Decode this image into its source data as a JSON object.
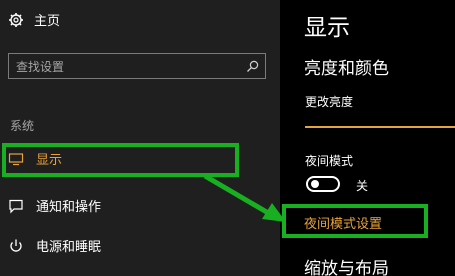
{
  "sidebar": {
    "home_label": "主页",
    "search_placeholder": "查找设置",
    "section_label": "系统",
    "items": [
      {
        "label": "显示",
        "icon": "monitor-icon",
        "active": true
      },
      {
        "label": "通知和操作",
        "icon": "message-icon",
        "active": false
      },
      {
        "label": "电源和睡眠",
        "icon": "power-icon",
        "active": false
      }
    ]
  },
  "main": {
    "title": "显示",
    "brightness_section": "亮度和颜色",
    "change_brightness_label": "更改亮度",
    "night_mode_label": "夜间模式",
    "night_mode_state": "关",
    "night_mode_settings_link": "夜间模式设置",
    "scale_section": "缩放与布局"
  },
  "annotations": {
    "highlight_color": "#18b020"
  },
  "colors": {
    "accent": "#e8a33a",
    "sidebar_bg": "#1f1f1f",
    "main_bg": "#000000"
  }
}
